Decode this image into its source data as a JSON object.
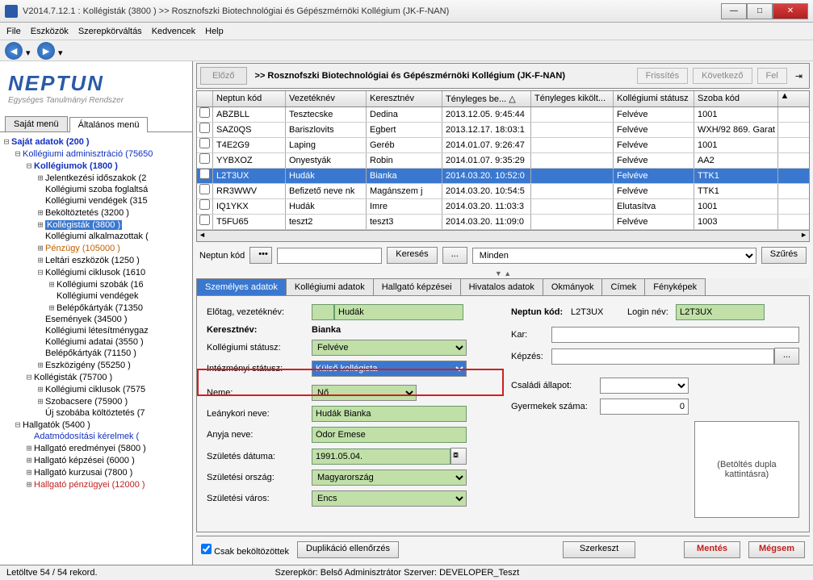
{
  "title": "V2014.7.12.1 : Kollégisták (3800  )  >> Rosznofszki Biotechnológiai és Gépészmérnöki Kollégium (JK-F-NAN)",
  "menus": [
    "File",
    "Eszközök",
    "Szerepkörváltás",
    "Kedvencek",
    "Help"
  ],
  "logo": {
    "main": "NEPTUN",
    "sub": "Egységes Tanulmányi Rendszer"
  },
  "sidetabs": [
    "Saját menü",
    "Általános menü"
  ],
  "tree": [
    {
      "d": 0,
      "e": "-",
      "c": "tblue",
      "t": "Saját adatok (200  )",
      "b": true
    },
    {
      "d": 1,
      "e": "-",
      "c": "tblue",
      "t": "Kollégiumi adminisztráció (75650"
    },
    {
      "d": 2,
      "e": "-",
      "c": "tblue",
      "t": "Kollégiumok (1800  )",
      "b": true
    },
    {
      "d": 3,
      "e": "+",
      "c": "",
      "t": "Jelentkezési időszakok (2"
    },
    {
      "d": 3,
      "e": "",
      "c": "",
      "t": "Kollégiumi szoba foglaltsá"
    },
    {
      "d": 3,
      "e": "",
      "c": "",
      "t": "Kollégiumi vendégek (315"
    },
    {
      "d": 3,
      "e": "+",
      "c": "",
      "t": "Beköltöztetés (3200  )"
    },
    {
      "d": 3,
      "e": "+",
      "c": "tsel",
      "t": "Kollégisták (3800  )"
    },
    {
      "d": 3,
      "e": "",
      "c": "",
      "t": "Kollégiumi alkalmazottak ("
    },
    {
      "d": 3,
      "e": "+",
      "c": "torange",
      "t": "Pénzügy (105000  )"
    },
    {
      "d": 3,
      "e": "+",
      "c": "",
      "t": "Leltári eszközök (1250  )"
    },
    {
      "d": 3,
      "e": "-",
      "c": "",
      "t": "Kollégiumi ciklusok (1610"
    },
    {
      "d": 4,
      "e": "+",
      "c": "",
      "t": "Kollégiumi szobák (16"
    },
    {
      "d": 4,
      "e": "",
      "c": "",
      "t": "Kollégiumi vendégek"
    },
    {
      "d": 4,
      "e": "+",
      "c": "",
      "t": "Belépőkártyák (71350"
    },
    {
      "d": 3,
      "e": "",
      "c": "",
      "t": "Események (34500  )"
    },
    {
      "d": 3,
      "e": "",
      "c": "",
      "t": "Kollégiumi létesítménygaz"
    },
    {
      "d": 3,
      "e": "",
      "c": "",
      "t": "Kollégiumi adatai (3550  )"
    },
    {
      "d": 3,
      "e": "",
      "c": "",
      "t": "Belépőkártyák (71150  )"
    },
    {
      "d": 3,
      "e": "+",
      "c": "",
      "t": "Eszközigény (55250  )"
    },
    {
      "d": 2,
      "e": "-",
      "c": "",
      "t": "Kollégisták (75700  )"
    },
    {
      "d": 3,
      "e": "+",
      "c": "",
      "t": "Kollégiumi ciklusok (7575"
    },
    {
      "d": 3,
      "e": "+",
      "c": "",
      "t": "Szobacsere (75900  )"
    },
    {
      "d": 3,
      "e": "",
      "c": "",
      "t": "Új szobába költöztetés (7"
    },
    {
      "d": 1,
      "e": "-",
      "c": "",
      "t": "Hallgatók (5400  )"
    },
    {
      "d": 2,
      "e": "",
      "c": "tblue",
      "t": "Adatmódosítási kérelmek ("
    },
    {
      "d": 2,
      "e": "+",
      "c": "",
      "t": "Hallgató eredményei (5800  )"
    },
    {
      "d": 2,
      "e": "+",
      "c": "",
      "t": "Hallgató képzései (6000  )"
    },
    {
      "d": 2,
      "e": "+",
      "c": "",
      "t": "Hallgató kurzusai (7800  )"
    },
    {
      "d": 2,
      "e": "+",
      "c": "tred",
      "t": "Hallgató pénzügyei (12000  )"
    }
  ],
  "hist": {
    "prev": "Előző",
    "title": ">> Rosznofszki Biotechnológiai és Gépészmérnöki Kollégium (JK-F-NAN)",
    "refresh": "Frissítés",
    "next": "Következő",
    "up": "Fel"
  },
  "cols": [
    "Neptun kód",
    "Vezetéknév",
    "Keresztnév",
    "Tényleges be... △",
    "Tényleges kikölt...",
    "Kollégiumi státusz",
    "Szoba kód"
  ],
  "rows": [
    [
      "ABZBLL",
      "Tesztecske",
      "Dedina",
      "2013.12.05. 9:45:44",
      "",
      "Felvéve",
      "1001"
    ],
    [
      "SAZ0QS",
      "Bariszlovits",
      "Egbert",
      "2013.12.17. 18:03:1",
      "",
      "Felvéve",
      "WXH/92 869. Garat"
    ],
    [
      "T4E2G9",
      "Laping",
      "Geréb",
      "2014.01.07. 9:26:47",
      "",
      "Felvéve",
      "1001"
    ],
    [
      "YYBXOZ",
      "Onyestyák",
      "Robin",
      "2014.01.07. 9:35:29",
      "",
      "Felvéve",
      "AA2"
    ],
    [
      "L2T3UX",
      "Hudák",
      "Bianka",
      "2014.03.20. 10:52:0",
      "",
      "Felvéve",
      "TTK1"
    ],
    [
      "RR3WWV",
      "Befizető neve nk",
      "Magánszem j",
      "2014.03.20. 10:54:5",
      "",
      "Felvéve",
      "TTK1"
    ],
    [
      "IQ1YKX",
      "Hudák",
      "Imre",
      "2014.03.20. 11:03:3",
      "",
      "Elutasítva",
      "1001"
    ],
    [
      "T5FU65",
      "teszt2",
      "teszt3",
      "2014.03.20. 11:09:0",
      "",
      "Felvéve",
      "1003"
    ]
  ],
  "selrow": 4,
  "search": {
    "label": "Neptun kód",
    "btn": "Keresés",
    "dots": "...",
    "filter": "Minden",
    "sz": "Szűrés"
  },
  "dtabs": [
    "Személyes adatok",
    "Kollégiumi adatok",
    "Hallgató képzései",
    "Hivatalos adatok",
    "Okmányok",
    "Címek",
    "Fényképek"
  ],
  "form": {
    "l_prefix": "Előtag, vezetéknév:",
    "v_lastname": "Hudák",
    "l_first": "Keresztnév:",
    "v_first": "Bianka",
    "l_kstat": "Kollégiumi státusz:",
    "v_kstat": "Felvéve",
    "l_istat": "Intézményi státusz:",
    "v_istat": "Külső kollégista",
    "l_nem": "Neme:",
    "v_nem": "Nő",
    "l_leany": "Leánykori neve:",
    "v_leany": "Hudák Bianka",
    "l_anya": "Anyja neve:",
    "v_anya": "Ódor Emese",
    "l_szul": "Születés dátuma:",
    "v_szul": "1991.05.04.",
    "l_orsz": "Születési ország:",
    "v_orsz": "Magyarország",
    "l_varos": "Születési város:",
    "v_varos": "Encs",
    "l_neptun": "Neptun kód:",
    "v_neptun": "L2T3UX",
    "l_login": "Login név:",
    "v_login": "L2T3UX",
    "l_kar": "Kar:",
    "l_kepz": "Képzés:",
    "l_csal": "Családi állapot:",
    "l_gyerm": "Gyermekek száma:",
    "v_gyerm": "0",
    "img": "(Betöltés dupla kattintásra)"
  },
  "bottom": {
    "chk": "Csak beköltözöttek",
    "dup": "Duplikáció ellenőrzés",
    "szerk": "Szerkeszt",
    "ment": "Mentés",
    "megsem": "Mégsem"
  },
  "status": {
    "rec": "Letöltve 54 / 54 rekord.",
    "role": "Szerepkör: Belső Adminisztrátor  Szerver: DEVELOPER_Teszt"
  }
}
